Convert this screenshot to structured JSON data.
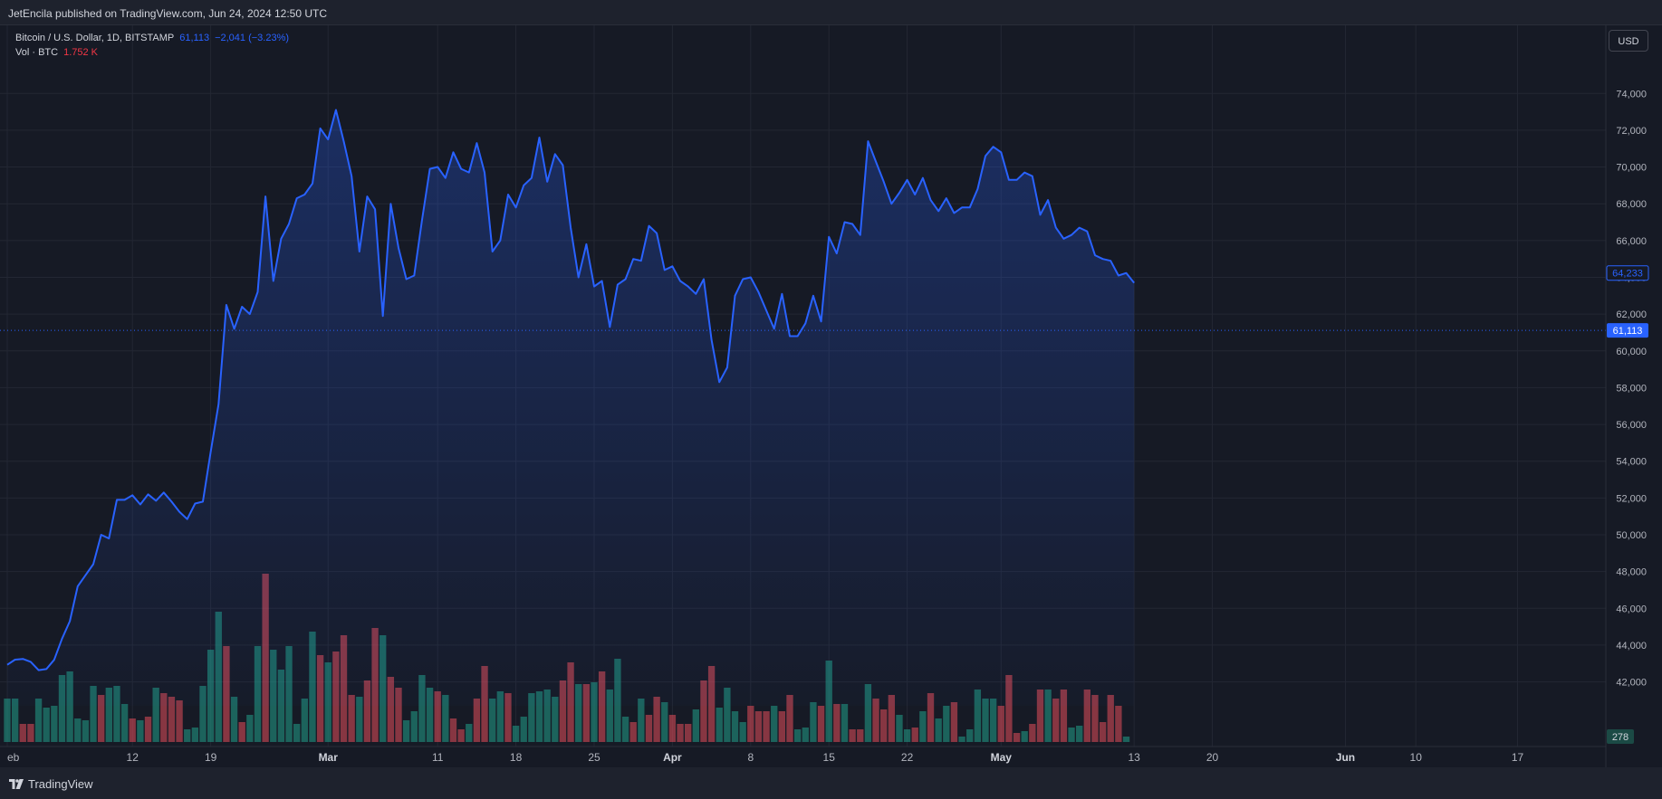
{
  "header": {
    "publish_text": "JetEncila published on TradingView.com, Jun 24, 2024 12:50 UTC"
  },
  "legend": {
    "symbol": "Bitcoin / U.S. Dollar, 1D, BITSTAMP",
    "last": "61,113",
    "change": "−2,041 (−3.23%)",
    "volume_label": "Vol · BTC",
    "volume_value": "1.752 K"
  },
  "currency_button": "USD",
  "footer": {
    "brand": "TradingView"
  },
  "colors": {
    "background": "#161a25",
    "line": "#2962ff",
    "volume_up": "#22ab94",
    "volume_down": "#f7525f",
    "grid": "#232733",
    "axis_text": "#b2b5be"
  },
  "chart_data": {
    "type": "area",
    "price_axis": {
      "ticks": [
        "74,000",
        "72,000",
        "70,000",
        "68,000",
        "66,000",
        "64,000",
        "62,000",
        "60,000",
        "58,000",
        "56,000",
        "54,000",
        "52,000",
        "50,000",
        "48,000",
        "46,000",
        "44,000",
        "42,000"
      ],
      "ylim": [
        40700,
        74800
      ]
    },
    "time_axis": [
      {
        "label": "eb",
        "index": 0
      },
      {
        "label": "12",
        "index": 16
      },
      {
        "label": "19",
        "index": 26
      },
      {
        "label": "Mar",
        "index": 41,
        "major": true
      },
      {
        "label": "11",
        "index": 55
      },
      {
        "label": "18",
        "index": 65
      },
      {
        "label": "25",
        "index": 75
      },
      {
        "label": "Apr",
        "index": 85,
        "major": true
      },
      {
        "label": "8",
        "index": 95
      },
      {
        "label": "15",
        "index": 105
      },
      {
        "label": "22",
        "index": 115
      },
      {
        "label": "May",
        "index": 127,
        "major": true
      },
      {
        "label": "13",
        "index": 144
      },
      {
        "label": "20",
        "index": 154
      },
      {
        "label": "Jun",
        "index": 171,
        "major": true
      },
      {
        "label": "10",
        "index": 180
      },
      {
        "label": "17",
        "index": 193
      }
    ],
    "price_labels": {
      "last": "61,113",
      "last_value": 61113,
      "secondary": "64,233",
      "secondary_value": 64233,
      "volume": "278"
    },
    "close": [
      42930,
      43210,
      43250,
      43090,
      42640,
      42700,
      43200,
      44350,
      45300,
      47200,
      47800,
      48400,
      50000,
      49800,
      51900,
      51900,
      52150,
      51650,
      52200,
      51850,
      52300,
      51800,
      51250,
      50850,
      51700,
      51800,
      54500,
      57100,
      62500,
      61200,
      62400,
      62000,
      63200,
      68400,
      63800,
      66100,
      66900,
      68300,
      68500,
      69100,
      72100,
      71500,
      73100,
      71400,
      69500,
      65400,
      68400,
      67700,
      61900,
      68000,
      65600,
      63900,
      64100,
      67100,
      69900,
      70000,
      69400,
      70800,
      69900,
      69700,
      71300,
      69700,
      65400,
      66000,
      68500,
      67800,
      69000,
      69400,
      71600,
      69200,
      70700,
      70100,
      66700,
      64000,
      65800,
      63500,
      63800,
      61300,
      63600,
      63900,
      65000,
      64900,
      66800,
      66400,
      64400,
      64600,
      63800,
      63500,
      63100,
      63900,
      60600,
      58300,
      59100,
      63000,
      63900,
      64000,
      63200,
      62200,
      61200,
      63100,
      60800,
      60800,
      61500,
      63000,
      61600,
      66200,
      65300,
      67000,
      66900,
      66300,
      71400,
      70300,
      69200,
      68000,
      68600,
      69300,
      68500,
      69400,
      68200,
      67600,
      68300,
      67500,
      67800,
      67800,
      68800,
      70600,
      71100,
      70800,
      69300,
      69300,
      69700,
      69500,
      67400,
      68200,
      66700,
      66100,
      66300,
      66700,
      66500,
      65200,
      65000,
      64900,
      64100,
      64233,
      63700
    ],
    "volume": [
      {
        "v": 24,
        "up": true
      },
      {
        "v": 24,
        "up": true
      },
      {
        "v": 10,
        "up": false
      },
      {
        "v": 10,
        "up": false
      },
      {
        "v": 24,
        "up": true
      },
      {
        "v": 19,
        "up": true
      },
      {
        "v": 20,
        "up": true
      },
      {
        "v": 37,
        "up": true
      },
      {
        "v": 39,
        "up": true
      },
      {
        "v": 13,
        "up": true
      },
      {
        "v": 12,
        "up": true
      },
      {
        "v": 31,
        "up": true
      },
      {
        "v": 26,
        "up": false
      },
      {
        "v": 30,
        "up": true
      },
      {
        "v": 31,
        "up": true
      },
      {
        "v": 21,
        "up": true
      },
      {
        "v": 13,
        "up": false
      },
      {
        "v": 12,
        "up": true
      },
      {
        "v": 14,
        "up": false
      },
      {
        "v": 30,
        "up": true
      },
      {
        "v": 27,
        "up": false
      },
      {
        "v": 25,
        "up": false
      },
      {
        "v": 23,
        "up": false
      },
      {
        "v": 7,
        "up": true
      },
      {
        "v": 8,
        "up": true
      },
      {
        "v": 31,
        "up": true
      },
      {
        "v": 51,
        "up": true
      },
      {
        "v": 72,
        "up": true
      },
      {
        "v": 53,
        "up": false
      },
      {
        "v": 25,
        "up": true
      },
      {
        "v": 11,
        "up": false
      },
      {
        "v": 15,
        "up": true
      },
      {
        "v": 53,
        "up": true
      },
      {
        "v": 93,
        "up": false
      },
      {
        "v": 51,
        "up": true
      },
      {
        "v": 40,
        "up": true
      },
      {
        "v": 53,
        "up": true
      },
      {
        "v": 10,
        "up": true
      },
      {
        "v": 24,
        "up": true
      },
      {
        "v": 61,
        "up": true
      },
      {
        "v": 48,
        "up": false
      },
      {
        "v": 44,
        "up": true
      },
      {
        "v": 50,
        "up": false
      },
      {
        "v": 59,
        "up": false
      },
      {
        "v": 26,
        "up": false
      },
      {
        "v": 25,
        "up": true
      },
      {
        "v": 34,
        "up": false
      },
      {
        "v": 63,
        "up": false
      },
      {
        "v": 59,
        "up": true
      },
      {
        "v": 36,
        "up": false
      },
      {
        "v": 30,
        "up": false
      },
      {
        "v": 12,
        "up": true
      },
      {
        "v": 17,
        "up": true
      },
      {
        "v": 37,
        "up": true
      },
      {
        "v": 30,
        "up": true
      },
      {
        "v": 28,
        "up": false
      },
      {
        "v": 26,
        "up": true
      },
      {
        "v": 13,
        "up": false
      },
      {
        "v": 7,
        "up": false
      },
      {
        "v": 10,
        "up": true
      },
      {
        "v": 24,
        "up": false
      },
      {
        "v": 42,
        "up": false
      },
      {
        "v": 24,
        "up": true
      },
      {
        "v": 28,
        "up": true
      },
      {
        "v": 27,
        "up": false
      },
      {
        "v": 9,
        "up": true
      },
      {
        "v": 14,
        "up": true
      },
      {
        "v": 27,
        "up": true
      },
      {
        "v": 28,
        "up": true
      },
      {
        "v": 29,
        "up": true
      },
      {
        "v": 25,
        "up": true
      },
      {
        "v": 34,
        "up": false
      },
      {
        "v": 44,
        "up": false
      },
      {
        "v": 32,
        "up": true
      },
      {
        "v": 32,
        "up": false
      },
      {
        "v": 33,
        "up": true
      },
      {
        "v": 39,
        "up": false
      },
      {
        "v": 29,
        "up": true
      },
      {
        "v": 46,
        "up": true
      },
      {
        "v": 14,
        "up": true
      },
      {
        "v": 11,
        "up": false
      },
      {
        "v": 24,
        "up": true
      },
      {
        "v": 15,
        "up": false
      },
      {
        "v": 25,
        "up": false
      },
      {
        "v": 22,
        "up": true
      },
      {
        "v": 15,
        "up": false
      },
      {
        "v": 10,
        "up": false
      },
      {
        "v": 10,
        "up": false
      },
      {
        "v": 18,
        "up": true
      },
      {
        "v": 34,
        "up": false
      },
      {
        "v": 42,
        "up": false
      },
      {
        "v": 19,
        "up": true
      },
      {
        "v": 30,
        "up": true
      },
      {
        "v": 17,
        "up": true
      },
      {
        "v": 11,
        "up": true
      },
      {
        "v": 20,
        "up": false
      },
      {
        "v": 17,
        "up": false
      },
      {
        "v": 17,
        "up": false
      },
      {
        "v": 20,
        "up": true
      },
      {
        "v": 17,
        "up": false
      },
      {
        "v": 26,
        "up": false
      },
      {
        "v": 7,
        "up": true
      },
      {
        "v": 8,
        "up": true
      },
      {
        "v": 22,
        "up": true
      },
      {
        "v": 20,
        "up": false
      },
      {
        "v": 45,
        "up": true
      },
      {
        "v": 21,
        "up": false
      },
      {
        "v": 21,
        "up": true
      },
      {
        "v": 7,
        "up": false
      },
      {
        "v": 7,
        "up": false
      },
      {
        "v": 32,
        "up": true
      },
      {
        "v": 24,
        "up": false
      },
      {
        "v": 18,
        "up": false
      },
      {
        "v": 26,
        "up": false
      },
      {
        "v": 15,
        "up": true
      },
      {
        "v": 7,
        "up": true
      },
      {
        "v": 8,
        "up": false
      },
      {
        "v": 17,
        "up": true
      },
      {
        "v": 27,
        "up": false
      },
      {
        "v": 13,
        "up": true
      },
      {
        "v": 20,
        "up": true
      },
      {
        "v": 22,
        "up": false
      },
      {
        "v": 3,
        "up": true
      },
      {
        "v": 7,
        "up": true
      },
      {
        "v": 29,
        "up": true
      },
      {
        "v": 24,
        "up": true
      },
      {
        "v": 24,
        "up": true
      },
      {
        "v": 20,
        "up": false
      },
      {
        "v": 37,
        "up": false
      },
      {
        "v": 5,
        "up": false
      },
      {
        "v": 6,
        "up": true
      },
      {
        "v": 10,
        "up": false
      },
      {
        "v": 29,
        "up": false
      },
      {
        "v": 29,
        "up": true
      },
      {
        "v": 24,
        "up": false
      },
      {
        "v": 29,
        "up": false
      },
      {
        "v": 8,
        "up": true
      },
      {
        "v": 9,
        "up": true
      },
      {
        "v": 29,
        "up": false
      },
      {
        "v": 26,
        "up": false
      },
      {
        "v": 11,
        "up": false
      },
      {
        "v": 26,
        "up": false
      },
      {
        "v": 20,
        "up": false
      },
      {
        "v": 3,
        "up": true
      }
    ]
  }
}
